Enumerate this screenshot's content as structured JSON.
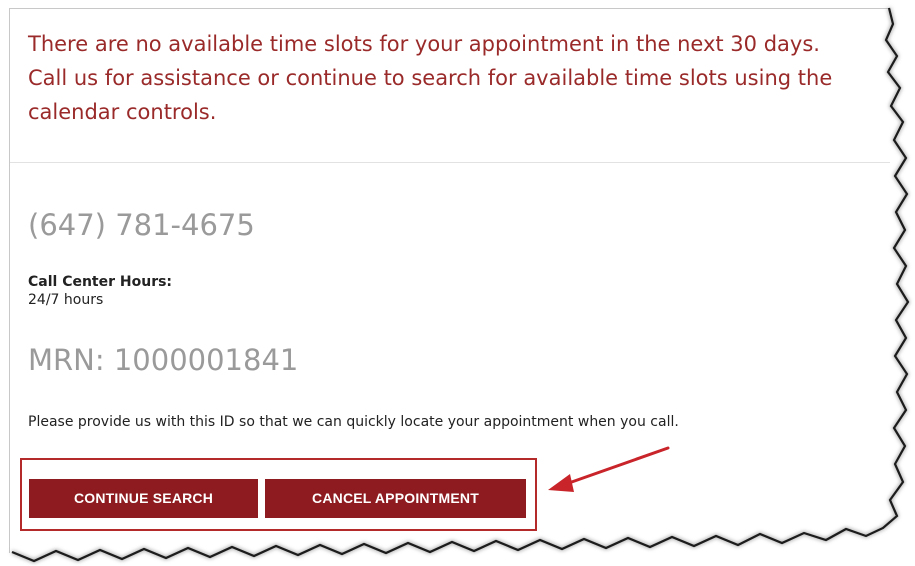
{
  "notice": {
    "message": "There are no available time slots for your appointment in the next 30 days. Call us for assistance or continue to search for available time slots using the calendar controls."
  },
  "contact": {
    "phone": "(647) 781-4675",
    "hours_label": "Call Center Hours:",
    "hours_value": "24/7 hours"
  },
  "patient": {
    "mrn": "MRN: 1000001841",
    "note": "Please provide us with this ID so that we can quickly locate your appointment when you call."
  },
  "actions": {
    "continue_label": "CONTINUE SEARCH",
    "cancel_label": "CANCEL APPOINTMENT"
  },
  "colors": {
    "accent": "#9a2a2a",
    "button": "#8e1b1f",
    "highlight": "#b42a2a"
  }
}
